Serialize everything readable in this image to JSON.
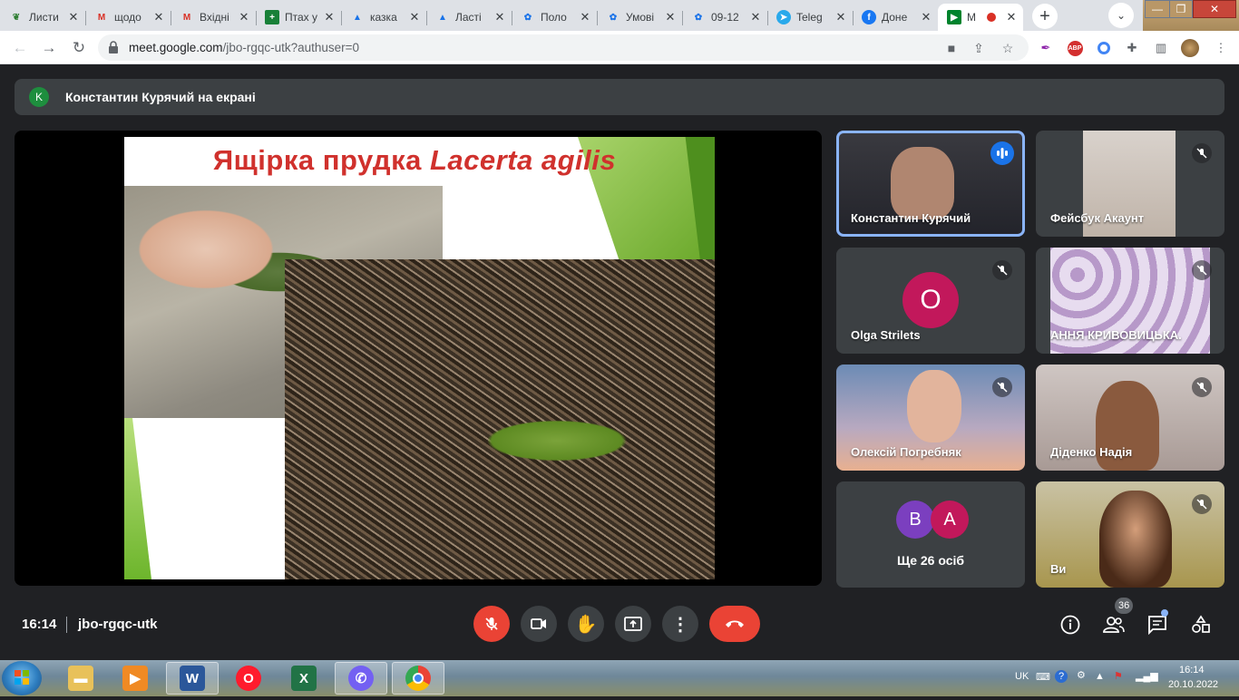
{
  "browser": {
    "tabs": [
      {
        "title": "Листи",
        "favicon": "leaf-icon",
        "color": "#2e7d32"
      },
      {
        "title": "щодо",
        "favicon": "gmail-icon",
        "color": "#d93025"
      },
      {
        "title": "Вхідні",
        "favicon": "gmail-icon",
        "color": "#d93025"
      },
      {
        "title": "Птах у",
        "favicon": "sheets-icon",
        "color": "#188038"
      },
      {
        "title": "казка",
        "favicon": "drive-icon",
        "color": "#1a73e8"
      },
      {
        "title": "Ласті",
        "favicon": "drive-icon",
        "color": "#1a73e8"
      },
      {
        "title": "Поло",
        "favicon": "emblem-icon",
        "color": "#1a73e8"
      },
      {
        "title": "Умові",
        "favicon": "emblem-icon",
        "color": "#1a73e8"
      },
      {
        "title": "09-12",
        "favicon": "emblem-icon",
        "color": "#1a73e8"
      },
      {
        "title": "Teleg",
        "favicon": "telegram-icon",
        "color": "#29a9eb"
      },
      {
        "title": "Доне",
        "favicon": "facebook-icon",
        "color": "#1877f2"
      },
      {
        "title": "M",
        "favicon": "meet-icon",
        "color": "#00832d",
        "active": true
      }
    ],
    "url_host": "meet.google.com",
    "url_path": "/jbo-rgqc-utk?authuser=0"
  },
  "meet": {
    "presenting_avatar": "K",
    "presenting_text": "Константин Курячий на екрані",
    "slide": {
      "title_ua": "Ящірка прудка ",
      "title_latin": "Lacerta agilis"
    },
    "participants": [
      {
        "name": "Константин Курячий",
        "speaking": true
      },
      {
        "name": "Фейсбук Акаунт",
        "muted": true
      },
      {
        "name": "Olga Strilets",
        "avatar": "O",
        "avatar_color": "#c2185b",
        "muted": true
      },
      {
        "name": "АННЯ КРИВОВИЦЬКА.",
        "muted": true
      },
      {
        "name": "Олексій Погребняк",
        "muted": true
      },
      {
        "name": "Діденко Надія",
        "muted": true
      },
      {
        "name": "Ви",
        "muted": true
      }
    ],
    "others": {
      "avatars": [
        {
          "letter": "B",
          "color": "#7b3fbf"
        },
        {
          "letter": "A",
          "color": "#c2185b"
        }
      ],
      "label": "Ще 26 осіб"
    },
    "time": "16:14",
    "meeting_code": "jbo-rgqc-utk",
    "people_count": "36"
  },
  "taskbar": {
    "lang": "UK",
    "clock_time": "16:14",
    "clock_date": "20.10.2022"
  }
}
